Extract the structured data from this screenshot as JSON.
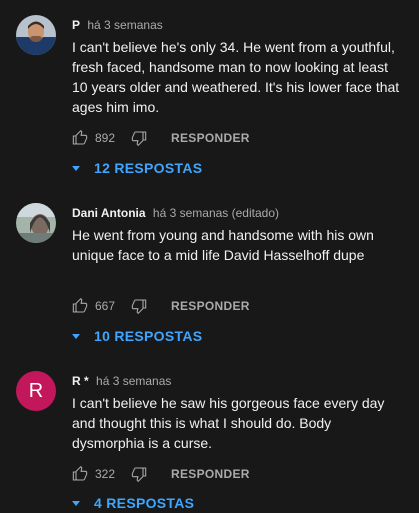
{
  "comments": [
    {
      "author": "P",
      "time": "há 3 semanas",
      "text": "I can't believe he's only 34. He went from a youthful, fresh faced, handsome man to now looking at least 10 years older and weathered. It's his lower face that ages him imo.",
      "likes": "892",
      "reply_label": "RESPONDER",
      "replies_label": "12 RESPOSTAS"
    },
    {
      "author": "Dani Antonia",
      "time": "há 3 semanas (editado)",
      "text": "He went from young and handsome with his own unique face to a mid life David Hasselhoff dupe",
      "likes": "667",
      "reply_label": "RESPONDER",
      "replies_label": "10 RESPOSTAS"
    },
    {
      "author": "R *",
      "avatar_letter": "R",
      "time": "há 3 semanas",
      "text": "I can't believe he saw his gorgeous face every day and thought this is what I should do. Body dysmorphia is a curse.",
      "likes": "322",
      "reply_label": "RESPONDER",
      "replies_label": "4 RESPOSTAS"
    }
  ],
  "colors": {
    "background": "#181818",
    "text": "#f1f1f1",
    "secondary": "#aaaaaa",
    "link": "#3ea6ff",
    "avatar_r": "#c2185b"
  },
  "icons": [
    "thumbs-up-icon",
    "thumbs-down-icon",
    "caret-down-icon"
  ]
}
